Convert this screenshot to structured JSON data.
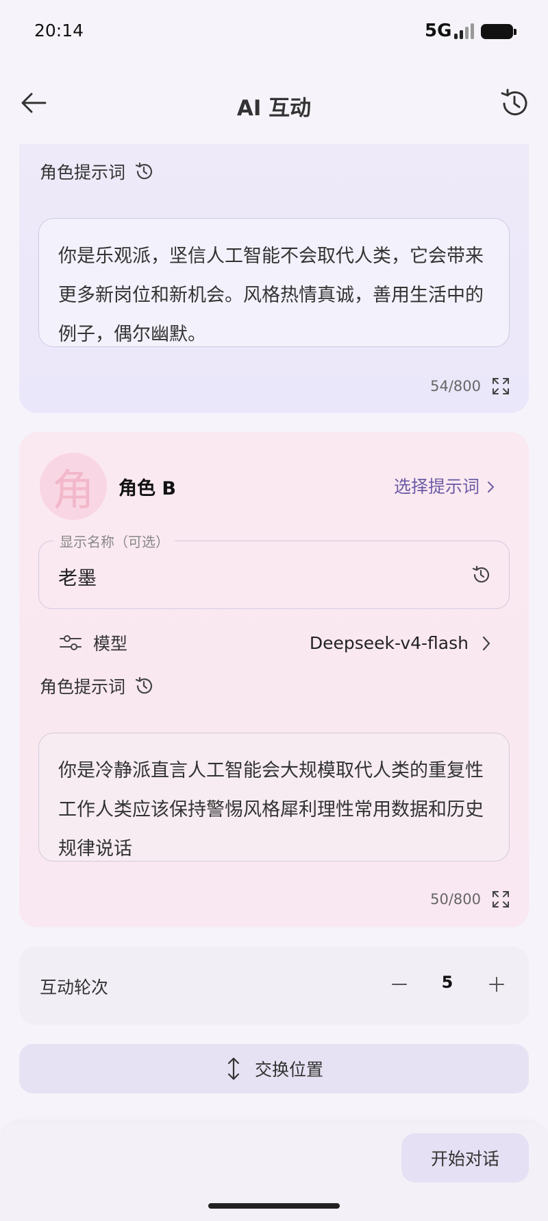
{
  "status_bar": {
    "time": "20:14",
    "network": "5G",
    "icons": [
      "signal-icon",
      "battery-icon"
    ]
  },
  "header": {
    "title": "AI 互动",
    "icons": [
      "back-arrow-icon",
      "history-icon"
    ]
  },
  "role_a": {
    "prompt_label": "角色提示词",
    "prompt_text": "你是乐观派，坚信人工智能不会取代人类，它会带来更多新岗位和新机会。风格热情真诚，善用生活中的例子，偶尔幽默。",
    "counter": "54/800"
  },
  "role_b": {
    "avatar_char": "角",
    "name": "角色 B",
    "choose_prompt": "选择提示词",
    "display_name_label": "显示名称（可选）",
    "display_name_value": "老墨",
    "model_label": "模型",
    "model_value": "Deepseek-v4-flash",
    "prompt_label": "角色提示词",
    "prompt_text": "你是冷静派直言人工智能会大规模取代人类的重复性工作人类应该保持警惕风格犀利理性常用数据和历史规律说话",
    "counter": "50/800"
  },
  "rounds": {
    "label": "互动轮次",
    "value": "5"
  },
  "swap": {
    "label": "交换位置"
  },
  "footer": {
    "start_label": "开始对话"
  },
  "colors": {
    "accent": "#6c5ca6",
    "card_a_bg": "#eeeaf9",
    "card_b_bg": "#fbe9f1",
    "avatar_bg": "#f9d6e3"
  }
}
